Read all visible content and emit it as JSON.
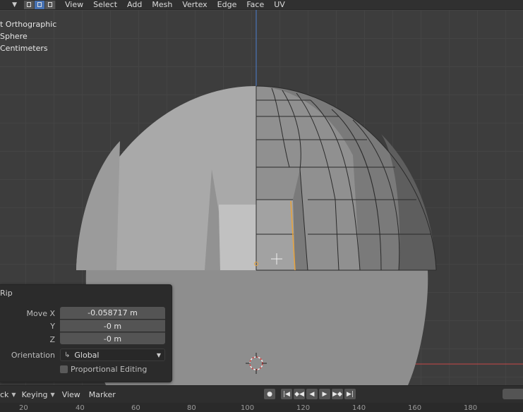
{
  "header": {
    "menu": [
      "View",
      "Select",
      "Add",
      "Mesh",
      "Vertex",
      "Edge",
      "Face",
      "UV"
    ]
  },
  "overlay": {
    "view_name": "t Orthographic",
    "object_name": "Sphere",
    "units": "Centimeters"
  },
  "rip_panel": {
    "title": "Rip",
    "move_x_label": "Move X",
    "move_x_value": "-0.058717 m",
    "y_label": "Y",
    "y_value": "-0 m",
    "z_label": "Z",
    "z_value": "-0 m",
    "orientation_label": "Orientation",
    "orientation_value": "Global",
    "proportional_label": "Proportional Editing"
  },
  "timeline": {
    "playback_dd": "ck",
    "keying": "Keying",
    "view": "View",
    "marker": "Marker",
    "ruler": [
      "20",
      "40",
      "60",
      "80",
      "100",
      "120",
      "140",
      "160",
      "180"
    ]
  },
  "icons": {
    "dropdown_chevron": "chevron-down-icon",
    "orientation": "global-axes-icon",
    "cursor": "3d-cursor-icon"
  },
  "colors": {
    "accent": "#4772b3",
    "axis_z": "#4a7ed0",
    "axis_x": "#c84646",
    "selected_edge": "#e8a33a"
  }
}
